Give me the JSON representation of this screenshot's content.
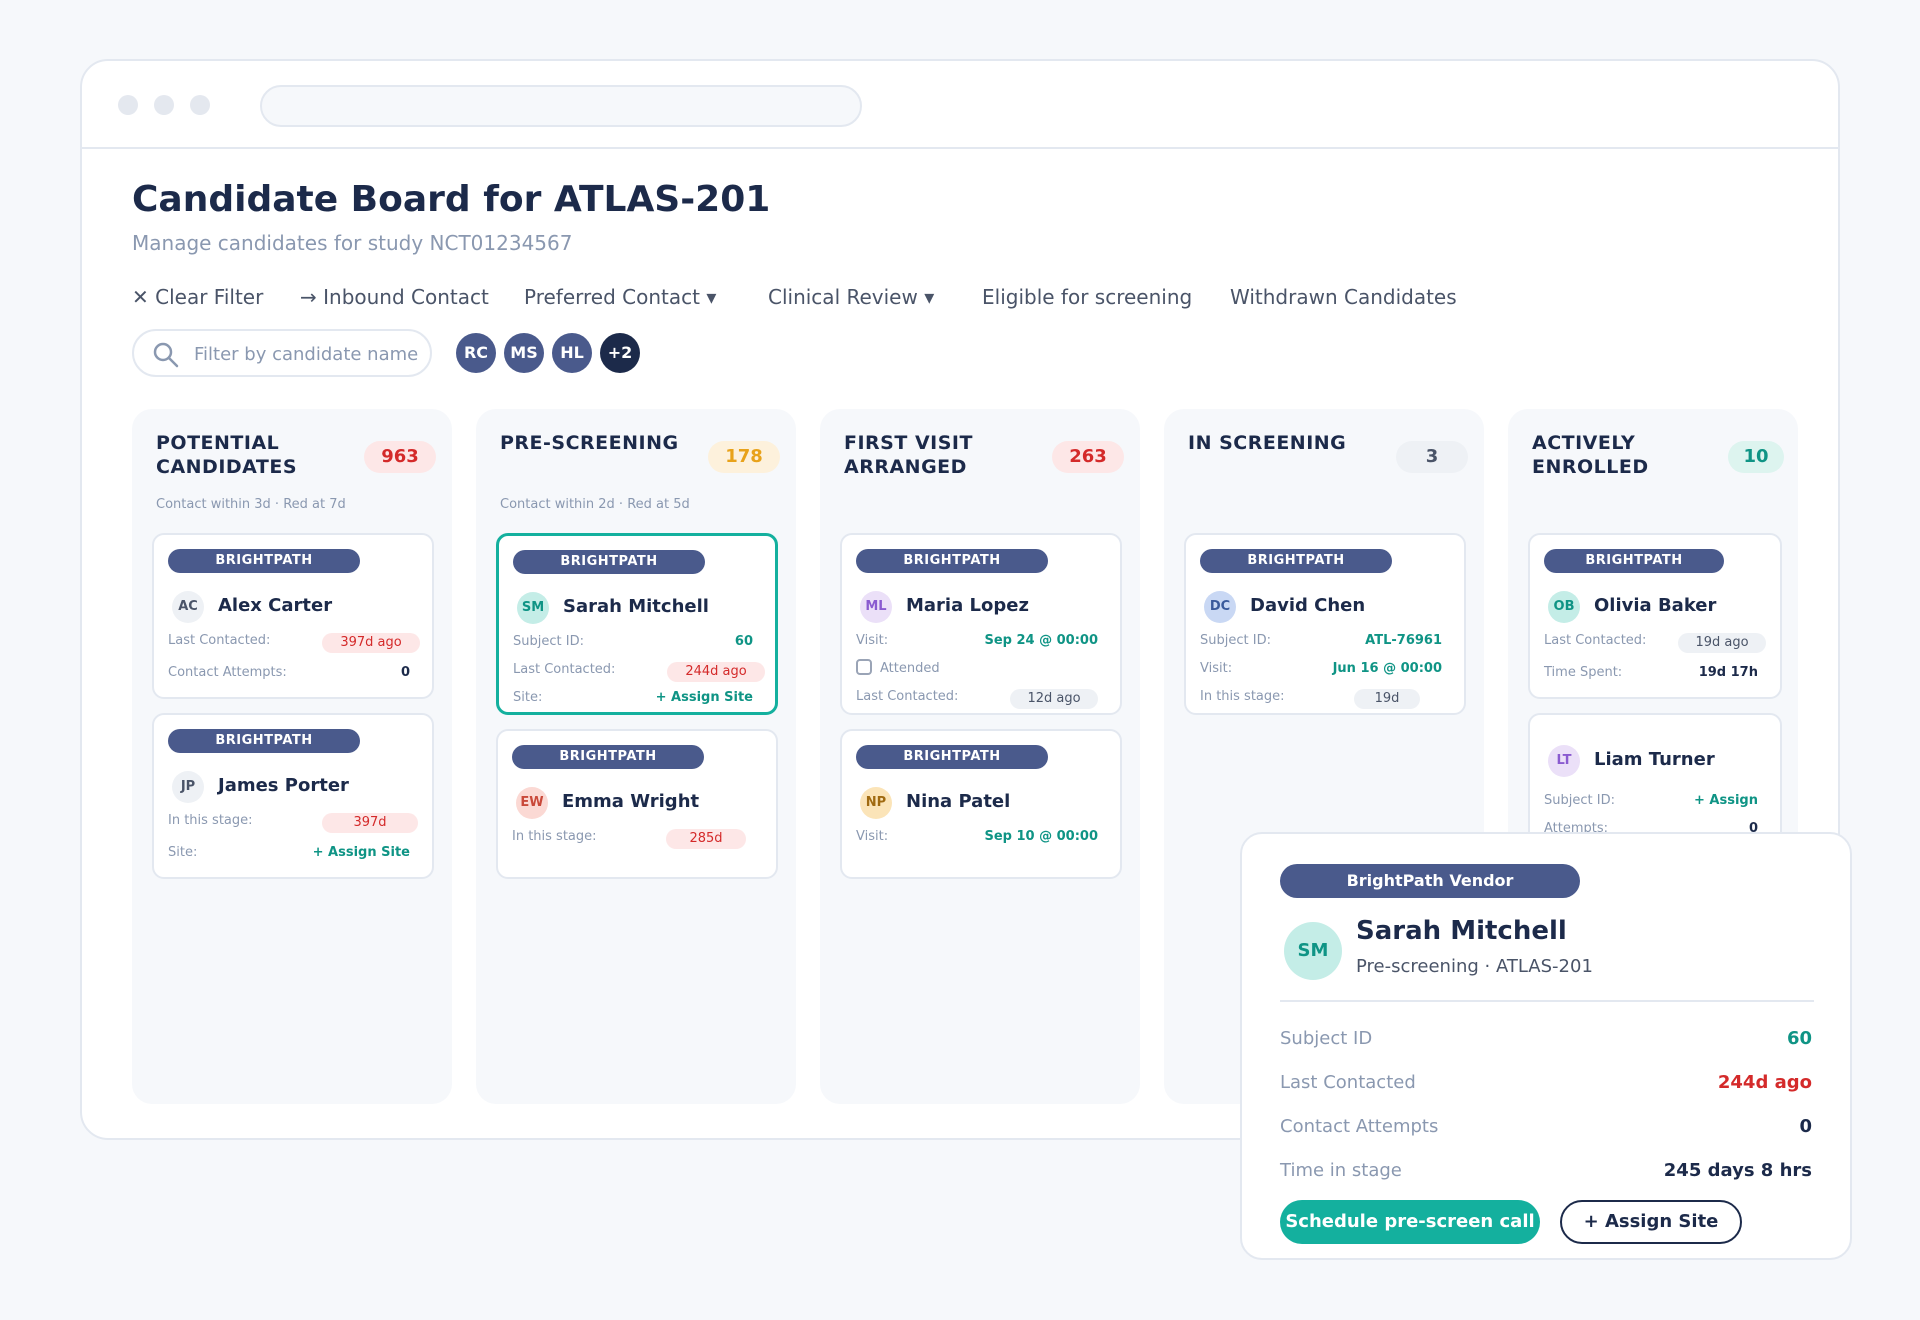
{
  "header": {
    "title": "Candidate Board for ATLAS-201",
    "subtitle": "Manage candidates for study NCT01234567"
  },
  "filters": [
    {
      "label": "✕ Clear Filter"
    },
    {
      "label": "→ Inbound Contact"
    },
    {
      "label": "Preferred Contact ▾"
    },
    {
      "label": "Clinical Review ▾"
    },
    {
      "label": "Eligible for screening"
    },
    {
      "label": "Withdrawn Candidates"
    }
  ],
  "search": {
    "placeholder": "Filter by candidate name",
    "value": ""
  },
  "assignees": [
    "RC",
    "MS",
    "HL",
    "+2"
  ],
  "columns": [
    {
      "title": "POTENTIAL CANDIDATES",
      "count": "963",
      "rule": "Contact within 3d · Red at 7d",
      "cards": [
        {
          "vendor": "BRIGHTPATH",
          "initials": "AC",
          "name": "Alex Carter",
          "fields": [
            {
              "label": "Last Contacted:",
              "value": "397d ago"
            },
            {
              "label": "Contact Attempts:",
              "value": "0"
            }
          ]
        },
        {
          "vendor": "BRIGHTPATH",
          "initials": "JP",
          "name": "James Porter",
          "fields": [
            {
              "label": "In this stage:",
              "value": "397d"
            },
            {
              "label": "Site:",
              "value": "+ Assign Site"
            }
          ]
        }
      ]
    },
    {
      "title": "PRE-SCREENING",
      "count": "178",
      "rule": "Contact within 2d · Red at 5d",
      "cards": [
        {
          "vendor": "BRIGHTPATH",
          "initials": "SM",
          "name": "Sarah Mitchell",
          "fields": [
            {
              "label": "Subject ID:",
              "value": "60"
            },
            {
              "label": "Last Contacted:",
              "value": "244d ago"
            },
            {
              "label": "Site:",
              "value": "+ Assign Site"
            }
          ]
        },
        {
          "vendor": "BRIGHTPATH",
          "initials": "EW",
          "name": "Emma Wright",
          "fields": [
            {
              "label": "In this stage:",
              "value": "285d"
            }
          ]
        }
      ]
    },
    {
      "title": "FIRST VISIT ARRANGED",
      "count": "263",
      "rule": "",
      "cards": [
        {
          "vendor": "BRIGHTPATH",
          "initials": "ML",
          "name": "Maria Lopez",
          "fields": [
            {
              "label": "Visit:",
              "value": "Sep 24 @ 00:00"
            },
            {
              "label": "Attended",
              "value": ""
            },
            {
              "label": "Last Contacted:",
              "value": "12d ago"
            }
          ]
        },
        {
          "vendor": "BRIGHTPATH",
          "initials": "NP",
          "name": "Nina Patel",
          "fields": [
            {
              "label": "Visit:",
              "value": "Sep 10 @ 00:00"
            }
          ]
        }
      ]
    },
    {
      "title": "IN SCREENING",
      "count": "3",
      "rule": "",
      "cards": [
        {
          "vendor": "BRIGHTPATH",
          "initials": "DC",
          "name": "David Chen",
          "fields": [
            {
              "label": "Subject ID:",
              "value": "ATL-76961"
            },
            {
              "label": "Visit:",
              "value": "Jun 16 @ 00:00"
            },
            {
              "label": "In this stage:",
              "value": "19d"
            }
          ]
        }
      ]
    },
    {
      "title": "ACTIVELY ENROLLED",
      "count": "10",
      "rule": "",
      "cards": [
        {
          "vendor": "BRIGHTPATH",
          "initials": "OB",
          "name": "Olivia Baker",
          "fields": [
            {
              "label": "Last Contacted:",
              "value": "19d ago"
            },
            {
              "label": "Time Spent:",
              "value": "19d 17h"
            }
          ]
        },
        {
          "vendor": "",
          "initials": "LT",
          "name": "Liam Turner",
          "fields": [
            {
              "label": "Subject ID:",
              "value": "+ Assign"
            },
            {
              "label": "Attempts:",
              "value": "0"
            }
          ]
        }
      ]
    }
  ],
  "popover": {
    "vendor": "BrightPath Vendor",
    "initials": "SM",
    "name": "Sarah Mitchell",
    "subtitle": "Pre-screening · ATLAS-201",
    "fields": [
      {
        "label": "Subject ID",
        "value": "60"
      },
      {
        "label": "Last Contacted",
        "value": "244d ago"
      },
      {
        "label": "Contact Attempts",
        "value": "0"
      },
      {
        "label": "Time in stage",
        "value": "245 days 8 hrs"
      }
    ],
    "primary_action": "Schedule pre-screen call",
    "secondary_action": "+ Assign Site"
  },
  "colors": {
    "accent_teal": "#14b09e",
    "vendor_pill": "#4a5a8c",
    "alert_red": "#d42a2a",
    "count_orange": "#e8a21a"
  }
}
